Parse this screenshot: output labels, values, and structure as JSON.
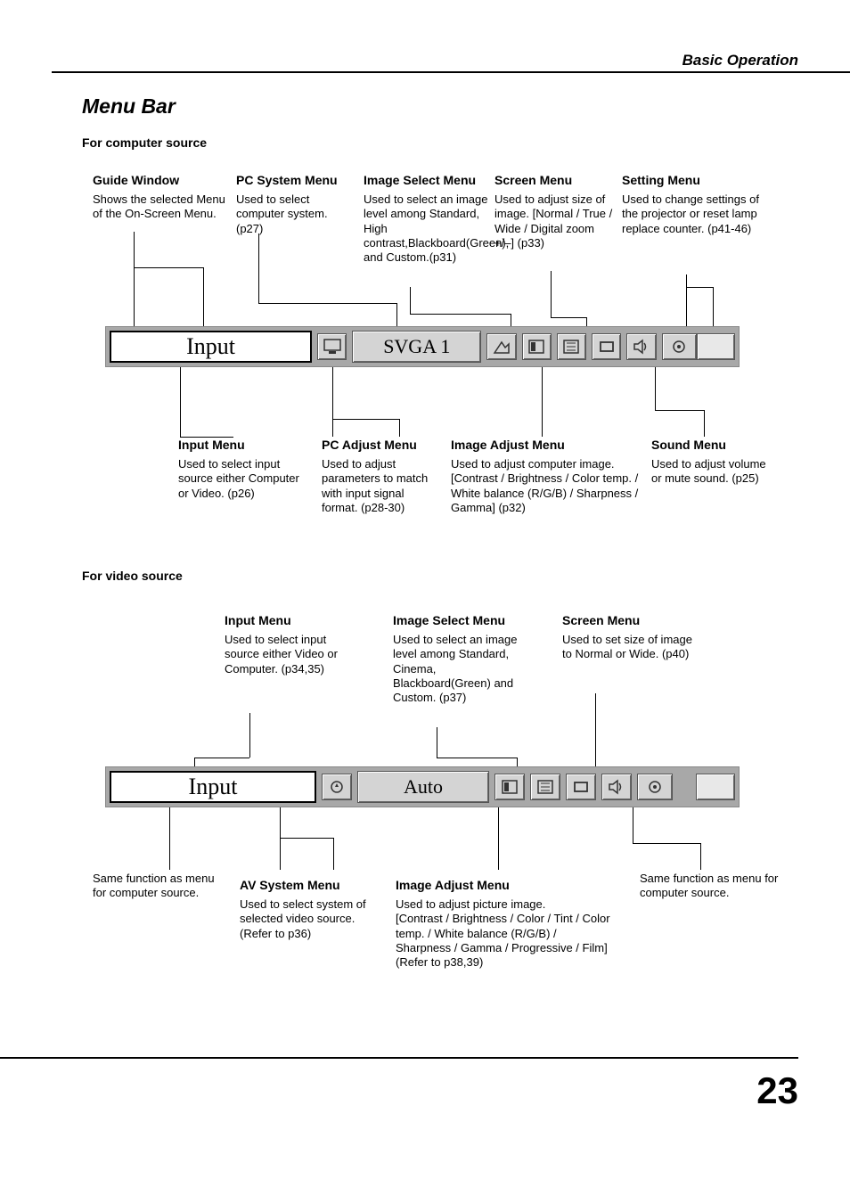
{
  "header": {
    "chapter": "Basic Operation"
  },
  "title": "Menu Bar",
  "page_number": "23",
  "sections": {
    "computer": "For computer source",
    "video": "For video source"
  },
  "menubar1": {
    "input_label": "Input",
    "mode_label": "SVGA 1"
  },
  "menubar2": {
    "input_label": "Input",
    "mode_label": "Auto"
  },
  "computer_top": {
    "guide": {
      "title": "Guide Window",
      "body": "Shows the selected Menu of the On-Screen Menu."
    },
    "pcsys": {
      "title": "PC System Menu",
      "body": "Used to select computer system. (p27)"
    },
    "imgsel": {
      "title": "Image Select Menu",
      "body": "Used to select  an image level among Standard, High contrast,Blackboard(Green), and Custom.(p31)"
    },
    "screen": {
      "title": "Screen Menu",
      "body": "Used to adjust size of image.  [Normal / True / Wide / Digital zoom +/–] (p33)"
    },
    "setting": {
      "title": "Setting Menu",
      "body": "Used to change settings of the projector or reset  lamp replace counter.   (p41-46)"
    }
  },
  "computer_bottom": {
    "input": {
      "title": "Input Menu",
      "body": "Used to select input source either Computer or Video.  (p26)"
    },
    "pcadj": {
      "title": "PC Adjust Menu",
      "body": "Used to adjust parameters to match with input signal format. (p28-30)"
    },
    "imgadj": {
      "title": "Image Adjust Menu",
      "body": "Used to adjust computer image. [Contrast / Brightness / Color temp. /  White balance (R/G/B) / Sharpness /  Gamma]   (p32)"
    },
    "sound": {
      "title": "Sound Menu",
      "body": "Used to adjust volume or mute sound.  (p25)"
    }
  },
  "video_top": {
    "input": {
      "title": "Input Menu",
      "body": "Used to select input source either Video or Computer. (p34,35)"
    },
    "imgsel": {
      "title": "Image Select Menu",
      "body": "Used to select an image level among Standard, Cinema, Blackboard(Green) and Custom. (p37)"
    },
    "screen": {
      "title": "Screen Menu",
      "body": "Used to set size of image to Normal or Wide. (p40)"
    }
  },
  "video_bottom": {
    "same_left": "Same function as menu for computer source.",
    "same_right": "Same function as menu for computer source.",
    "avsys": {
      "title": "AV System Menu",
      "body": "Used to select system of selected video source. (Refer to p36)"
    },
    "imgadj": {
      "title": "Image Adjust Menu",
      "body": " Used to adjust picture image.\n[Contrast / Brightness / Color / Tint / Color temp. / White balance (R/G/B) / Sharpness / Gamma / Progressive / Film]\n (Refer to p38,39)"
    }
  }
}
